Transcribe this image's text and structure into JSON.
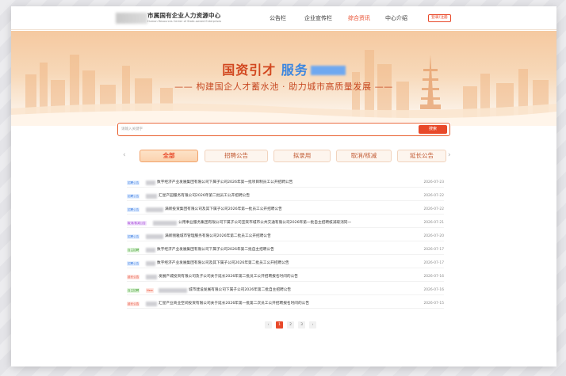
{
  "header": {
    "title": "市属国有企业人力资源中心",
    "subtitle": "Human Resources Center of State-owned Enterprises",
    "nav": [
      "公告栏",
      "企业宣传栏",
      "综合资讯",
      "中心介绍"
    ],
    "active_nav": "综合资讯",
    "login_label": "登录/注册"
  },
  "banner": {
    "title_main": "国资引才",
    "title_blue": "服务",
    "slogan": "—— 构建国企人才蓄水池 · 助力城市高质量发展 ——"
  },
  "search": {
    "placeholder": "请输入关键字",
    "button_label": "搜索"
  },
  "tabs": {
    "prev": "‹",
    "next": "›",
    "items": [
      "全部",
      "招聘公告",
      "拟录用",
      "取消/核减",
      "延长公告"
    ],
    "active": "全部"
  },
  "list": [
    {
      "badge": "招聘公告",
      "badge_color": "blue",
      "title": "数字经济产业发展集团有限公司下属子公司2026年第一批项目制员工公开招聘公告",
      "date": "2026-07-23"
    },
    {
      "badge": "招聘公告",
      "badge_color": "blue",
      "title": "汇星产园服务有限公司2026年第二批员工公开招聘公告",
      "date": "2026-07-22"
    },
    {
      "badge": "招聘公告",
      "badge_color": "blue",
      "title": "满新投资集团有限公司及其下属子公司2026年第一批员工公开招聘公告",
      "date": "2026-07-22"
    },
    {
      "badge": "取消/核减公告",
      "badge_color": "purple",
      "title": "公用事业服务集团有限公司下属子公司宜宾市城市公共交通有限公司2026年第一批自主招聘核减取消同一",
      "date": "2026-07-21"
    },
    {
      "badge": "招聘公告",
      "badge_color": "blue",
      "title": "满新丽雅城市管理服务有限公司2026年第二批员工公开招聘公告",
      "date": "2026-07-20"
    },
    {
      "badge": "自主招聘",
      "badge_color": "green",
      "title": "数字经济产业发展集团有限公司下属子公司2026年第二批自主招聘公告",
      "date": "2026-07-17"
    },
    {
      "badge": "招聘公告",
      "badge_color": "blue",
      "title": "数字经济产业发展集团有限公司及其下属子公司2026年第二批员工公开招聘公告",
      "date": "2026-07-17"
    },
    {
      "badge": "延长公告",
      "badge_color": "red",
      "title": "发展产城投资有限公司及子公司关于延长2026年第二批员工公开招聘报名时间的公告",
      "date": "2026-07-16"
    },
    {
      "badge": "自主招聘",
      "badge_color": "green",
      "title": "城市建设发展有限公司下属子公司2026年第二批自主招聘公告",
      "date": "2026-07-16",
      "hot": "New"
    },
    {
      "badge": "延长公告",
      "badge_color": "red",
      "title": "汇星产业商业空间投资有限公司关于延长2026年第一批第二次员工公开招聘报名时间的公告",
      "date": "2026-07-15"
    }
  ],
  "pagination": {
    "prev": "‹",
    "pages": [
      "1",
      "2",
      "3"
    ],
    "active": "1",
    "next": "›"
  },
  "colors": {
    "accent": "#e8492a",
    "blue": "#3b86e0"
  }
}
